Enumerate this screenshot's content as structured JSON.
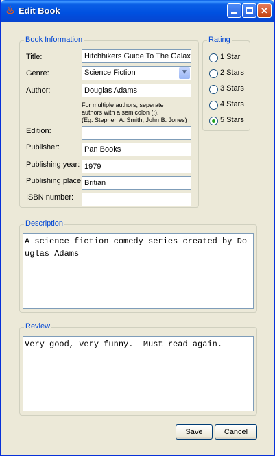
{
  "window": {
    "title": "Edit Book",
    "minimize_label": "",
    "maximize_label": "",
    "close_label": "✕"
  },
  "book_info": {
    "legend": "Book Information",
    "title_label": "Title:",
    "title_value": "Hitchhikers Guide To The Galax",
    "genre_label": "Genre:",
    "genre_value": "Science Fiction",
    "author_label": "Author:",
    "author_value": "Douglas Adams",
    "author_hint_1": "For multiple authors, seperate",
    "author_hint_2": "authors with a semicolon (;).",
    "author_hint_3": "(Eg. Stephen A. Smith; John B. Jones)",
    "edition_label": "Edition:",
    "edition_value": "",
    "publisher_label": "Publisher:",
    "publisher_value": "Pan Books",
    "year_label": "Publishing year:",
    "year_value": "1979",
    "place_label": "Publishing place:",
    "place_value": "Britian",
    "isbn_label": "ISBN number:",
    "isbn_value": ""
  },
  "rating": {
    "legend": "Rating",
    "options": [
      "1 Star",
      "2 Stars",
      "3 Stars",
      "4 Stars",
      "5 Stars"
    ],
    "selected": "5 Stars"
  },
  "description": {
    "legend": "Description",
    "text": "A science fiction comedy series created by Douglas Adams"
  },
  "review": {
    "legend": "Review",
    "text": "Very good, very funny.  Must read again."
  },
  "buttons": {
    "save": "Save",
    "cancel": "Cancel"
  },
  "colors": {
    "title_bar": "#0a5fe6",
    "legend_text": "#0046d5",
    "selected_radio": "#21a121"
  }
}
